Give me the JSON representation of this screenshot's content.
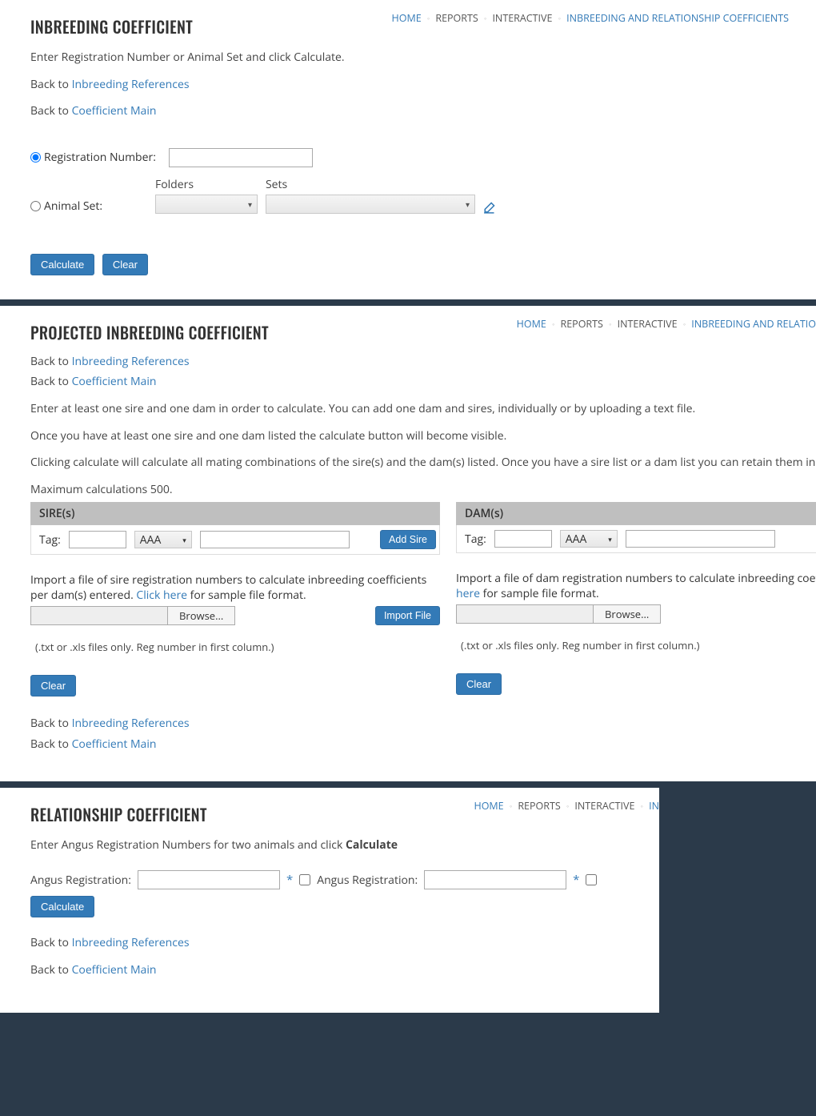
{
  "breadcrumb": {
    "home": "HOME",
    "reports": "REPORTS",
    "interactive": "INTERACTIVE",
    "current": "INBREEDING AND RELATIONSHIP COEFFICIENTS",
    "current_trunc1": "INBREEDING AND RELATIO",
    "current_trunc2": "IN"
  },
  "p1": {
    "title": "INBREEDING COEFFICIENT",
    "intro": "Enter Registration Number or Animal Set and click Calculate.",
    "back_prefix": "Back to ",
    "inbreeding_ref": "Inbreeding References",
    "coeff_main": "Coefficient Main",
    "reg_label": "Registration Number:",
    "animal_set_label": "Animal Set:",
    "folders_label": "Folders",
    "sets_label": "Sets",
    "calculate": "Calculate",
    "clear": "Clear"
  },
  "p2": {
    "title": "PROJECTED INBREEDING COEFFICIENT",
    "back_prefix": "Back to ",
    "inbreeding_ref": "Inbreeding References",
    "coeff_main": "Coefficient Main",
    "para1": "Enter at least one sire and one dam in order to calculate. You can add one dam and sires, individually or by uploading a text file.",
    "para2": "Once you have at least one sire and one dam listed the calculate button will become visible.",
    "para3": "Clicking calculate will calculate all mating combinations of the sire(s) and the dam(s) listed. Once you have a sire list or a dam list you can retain them in subsequent calculations or add and remove individuals from the list as needed.",
    "para4": "Maximum calculations 500.",
    "sires_head": "SIRE(s)",
    "dams_head": "DAM(s)",
    "tag_label": "Tag:",
    "assoc_default": "AAA",
    "add_sire": "Add Sire",
    "sire_import_text_a": "Import a file of sire registration numbers to calculate inbreeding coefficients per dam(s) entered. ",
    "dam_import_text_a": "Import a file of dam registration numbers to calculate inbreeding coefficients per sire(s) entered. ",
    "click_here": "Click here",
    "import_text_b": " for sample file format.",
    "browse": "Browse...",
    "import_file": "Import File",
    "file_note": "(.txt or .xls files only. Reg number in first column.)",
    "clear": "Clear"
  },
  "p3": {
    "title": "RELATIONSHIP COEFFICIENT",
    "intro_a": "Enter Angus Registration Numbers for two animals and click  ",
    "intro_b": "Calculate",
    "angus_label": "Angus Registration:",
    "calculate": "Calculate",
    "back_prefix": "Back to ",
    "inbreeding_ref": "Inbreeding References",
    "coeff_main": "Coefficient Main"
  }
}
